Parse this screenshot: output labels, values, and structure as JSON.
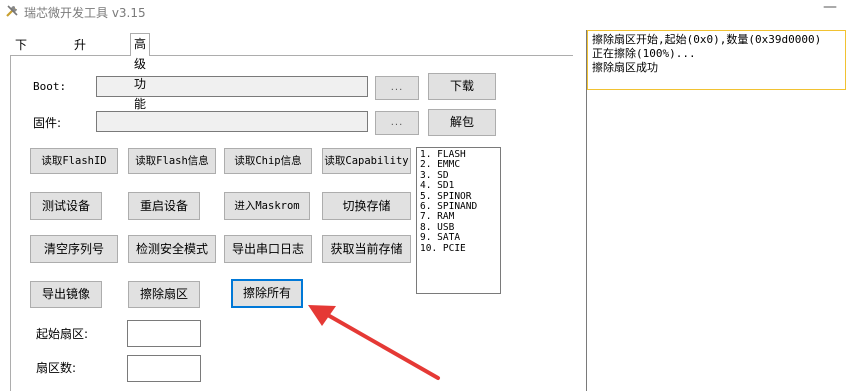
{
  "window": {
    "title": "瑞芯微开发工具 v3.15",
    "minimize_symbol": "—"
  },
  "tabs": [
    {
      "label": "下载镜像"
    },
    {
      "label": "升级固件"
    },
    {
      "label": "高级功能"
    }
  ],
  "boot": {
    "label": "Boot:",
    "value": "",
    "browse_label": "...",
    "action_label": "下载"
  },
  "firmware": {
    "label": "固件:",
    "value": "",
    "browse_label": "...",
    "action_label": "解包"
  },
  "buttons": {
    "read_flash_id": "读取FlashID",
    "read_flash_info": "读取Flash信息",
    "read_chip_info": "读取Chip信息",
    "read_capability": "读取Capability",
    "test_device": "测试设备",
    "reset_device": "重启设备",
    "enter_maskrom": "进入Maskrom",
    "switch_storage": "切换存储",
    "clear_serial": "清空序列号",
    "detect_secure_mode": "检测安全模式",
    "export_serial_log": "导出串口日志",
    "get_current_storage": "获取当前存储",
    "export_image": "导出镜像",
    "erase_sector": "擦除扇区",
    "erase_all": "擦除所有"
  },
  "storage_list": [
    "1. FLASH",
    "2. EMMC",
    "3. SD",
    "4. SD1",
    "5. SPINOR",
    "6. SPINAND",
    "7. RAM",
    "8. USB",
    "9. SATA",
    "10. PCIE"
  ],
  "start_sector": {
    "label": "起始扇区:",
    "value": ""
  },
  "sector_count": {
    "label": "扇区数:",
    "value": ""
  },
  "log": [
    "擦除扇区开始,起始(0x0),数量(0x39d0000)",
    "正在擦除(100%)...",
    "擦除扇区成功"
  ],
  "colors": {
    "focus_border": "#0078d7",
    "log_border": "#f1c232",
    "arrow": "#e53935"
  }
}
